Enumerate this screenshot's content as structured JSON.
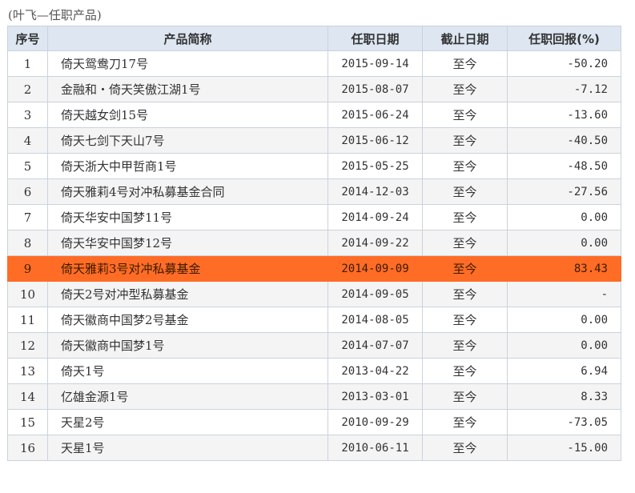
{
  "caption": "(叶飞—任职产品)",
  "colors": {
    "header_bg": "#dde6f1",
    "highlight_bg": "#ff6c26",
    "border": "#c9d3de"
  },
  "table": {
    "headers": {
      "no": "序号",
      "name": "产品简称",
      "start": "任职日期",
      "end": "截止日期",
      "return": "任职回报(%)"
    },
    "rows": [
      {
        "no": "1",
        "name": "倚天鸳鸯刀17号",
        "start": "2015-09-14",
        "end": "至今",
        "return": "-50.20"
      },
      {
        "no": "2",
        "name": "金融和・倚天笑傲江湖1号",
        "start": "2015-08-07",
        "end": "至今",
        "return": "-7.12"
      },
      {
        "no": "3",
        "name": "倚天越女剑15号",
        "start": "2015-06-24",
        "end": "至今",
        "return": "-13.60"
      },
      {
        "no": "4",
        "name": "倚天七剑下天山7号",
        "start": "2015-06-12",
        "end": "至今",
        "return": "-40.50"
      },
      {
        "no": "5",
        "name": "倚天浙大中甲哲商1号",
        "start": "2015-05-25",
        "end": "至今",
        "return": "-48.50"
      },
      {
        "no": "6",
        "name": "倚天雅莉4号对冲私募基金合同",
        "start": "2014-12-03",
        "end": "至今",
        "return": "-27.56"
      },
      {
        "no": "7",
        "name": "倚天华安中国梦11号",
        "start": "2014-09-24",
        "end": "至今",
        "return": "0.00"
      },
      {
        "no": "8",
        "name": "倚天华安中国梦12号",
        "start": "2014-09-22",
        "end": "至今",
        "return": "0.00"
      },
      {
        "no": "9",
        "name": "倚天雅莉3号对冲私募基金",
        "start": "2014-09-09",
        "end": "至今",
        "return": "83.43",
        "highlighted": true
      },
      {
        "no": "10",
        "name": "倚天2号对冲型私募基金",
        "start": "2014-09-05",
        "end": "至今",
        "return": "-"
      },
      {
        "no": "11",
        "name": "倚天徽商中国梦2号基金",
        "start": "2014-08-05",
        "end": "至今",
        "return": "0.00"
      },
      {
        "no": "12",
        "name": "倚天徽商中国梦1号",
        "start": "2014-07-07",
        "end": "至今",
        "return": "0.00"
      },
      {
        "no": "13",
        "name": "倚天1号",
        "start": "2013-04-22",
        "end": "至今",
        "return": "6.94"
      },
      {
        "no": "14",
        "name": "亿雄金源1号",
        "start": "2013-03-01",
        "end": "至今",
        "return": "8.33"
      },
      {
        "no": "15",
        "name": "天星2号",
        "start": "2010-09-29",
        "end": "至今",
        "return": "-73.05"
      },
      {
        "no": "16",
        "name": "天星1号",
        "start": "2010-06-11",
        "end": "至今",
        "return": "-15.00"
      }
    ]
  }
}
